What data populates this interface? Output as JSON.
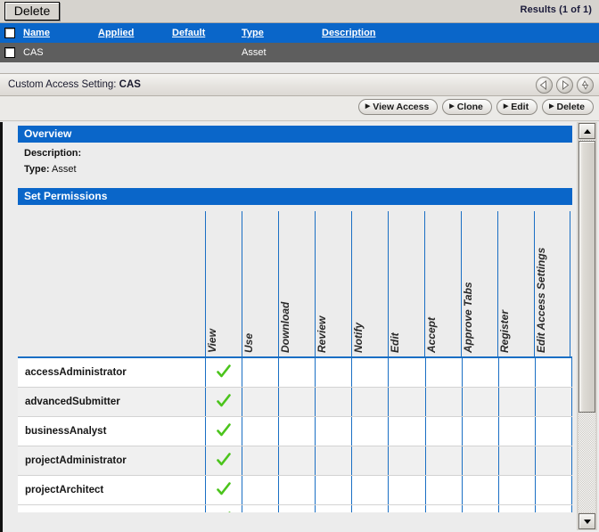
{
  "toolbar": {
    "delete_label": "Delete",
    "results_text": "Results (1 of 1)"
  },
  "results_grid": {
    "columns": [
      "Name",
      "Applied",
      "Default",
      "Type",
      "Description"
    ],
    "rows": [
      {
        "checked": false,
        "name": "CAS",
        "applied": "",
        "default": "",
        "type": "Asset",
        "description": ""
      }
    ]
  },
  "detail": {
    "title_prefix": "Custom Access Setting:",
    "title_value": "CAS",
    "nav_buttons": [
      "back-icon",
      "forward-icon",
      "up-down-icon"
    ],
    "actions": [
      {
        "label": "View Access",
        "marker": "▶"
      },
      {
        "label": "Clone",
        "marker": "▶"
      },
      {
        "label": "Edit",
        "marker": "▶"
      },
      {
        "label": "Delete",
        "marker": "▶"
      }
    ]
  },
  "overview": {
    "section_title": "Overview",
    "description_label": "Description:",
    "description_value": "",
    "type_label": "Type:",
    "type_value": "Asset"
  },
  "permissions": {
    "section_title": "Set Permissions",
    "columns": [
      "View",
      "Use",
      "Download",
      "Review",
      "Notify",
      "Edit",
      "Accept",
      "Approve Tabs",
      "Register",
      "Edit Access Settings"
    ],
    "rows": [
      {
        "role": "accessAdministrator",
        "values": [
          true,
          false,
          false,
          false,
          false,
          false,
          false,
          false,
          false,
          false
        ]
      },
      {
        "role": "advancedSubmitter",
        "values": [
          true,
          false,
          false,
          false,
          false,
          false,
          false,
          false,
          false,
          false
        ]
      },
      {
        "role": "businessAnalyst",
        "values": [
          true,
          false,
          false,
          false,
          false,
          false,
          false,
          false,
          false,
          false
        ]
      },
      {
        "role": "projectAdministrator",
        "values": [
          true,
          false,
          false,
          false,
          false,
          false,
          false,
          false,
          false,
          false
        ]
      },
      {
        "role": "projectArchitect",
        "values": [
          true,
          false,
          false,
          false,
          false,
          false,
          false,
          false,
          false,
          false
        ]
      }
    ],
    "check_color": "#4bc41c"
  },
  "colors": {
    "header_blue": "#0a66c9",
    "row_gray": "#5e5e5e",
    "grid_blue": "#1a6fc4",
    "panel_bg": "#ececec",
    "chrome_bg": "#d6d3ce"
  },
  "scrollbar": {
    "up_icon": "scroll-up-icon",
    "down_icon": "scroll-down-icon",
    "thumb": "scroll-thumb"
  }
}
